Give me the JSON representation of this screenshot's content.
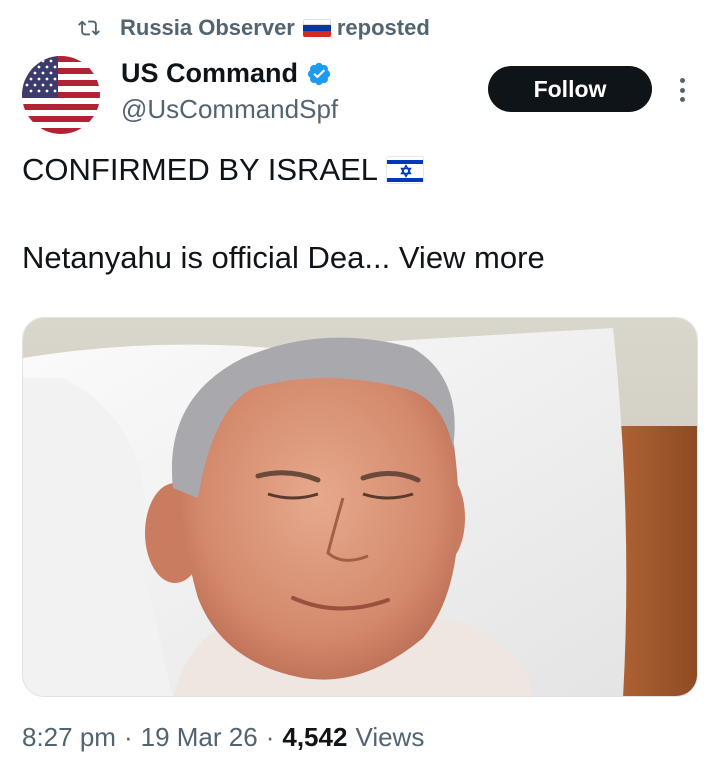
{
  "repost": {
    "icon": "repost-icon",
    "reposter_name": "Russia Observer",
    "reposter_flag": "russia-flag",
    "reposted_label": "reposted"
  },
  "author": {
    "avatar": "us-flag-avatar",
    "display_name": "US Command",
    "verified_icon": "verified-badge-icon",
    "handle": "@UsCommandSpf"
  },
  "actions": {
    "follow_label": "Follow",
    "more_icon": "more-vertical-icon"
  },
  "tweet": {
    "line1": "CONFIRMED BY ISRAEL",
    "line1_flag": "israel-flag",
    "line2": "Netanyahu is official Dea...",
    "view_more_label": "View more",
    "media": "photo-man-in-hospital-bed"
  },
  "meta": {
    "time": "8:27 pm",
    "separator": "·",
    "date": "19 Mar 26",
    "views_count": "4,542",
    "views_label": "Views"
  },
  "colors": {
    "text_primary": "#0f1419",
    "text_secondary": "#536471",
    "verified_blue": "#1d9bf0",
    "follow_bg": "#0f1419"
  }
}
